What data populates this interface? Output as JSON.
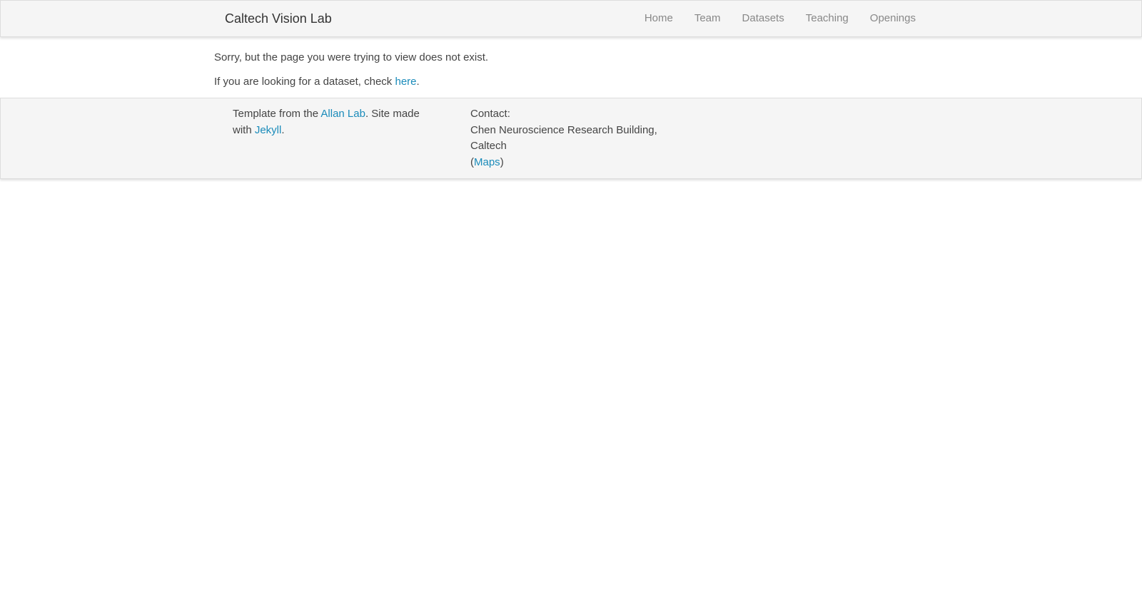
{
  "navbar": {
    "brand": "Caltech Vision Lab",
    "items": [
      {
        "label": "Home"
      },
      {
        "label": "Team"
      },
      {
        "label": "Datasets"
      },
      {
        "label": "Teaching"
      },
      {
        "label": "Openings"
      }
    ]
  },
  "main": {
    "error_message": "Sorry, but the page you were trying to view does not exist.",
    "dataset_prefix": "If you are looking for a dataset, check ",
    "dataset_link": "here",
    "dataset_suffix": "."
  },
  "footer": {
    "template_prefix": "Template from the ",
    "template_link": "Allan Lab",
    "template_middle": ". Site made with ",
    "jekyll_link": "Jekyll",
    "template_suffix": ".",
    "contact_label": "Contact:",
    "address": "Chen Neuroscience Research Building, Caltech",
    "maps_open": "(",
    "maps_link": "Maps",
    "maps_close": ")"
  },
  "colors": {
    "link": "#1a8bba",
    "nav_text": "#888888",
    "bar_background": "#f5f5f5"
  }
}
